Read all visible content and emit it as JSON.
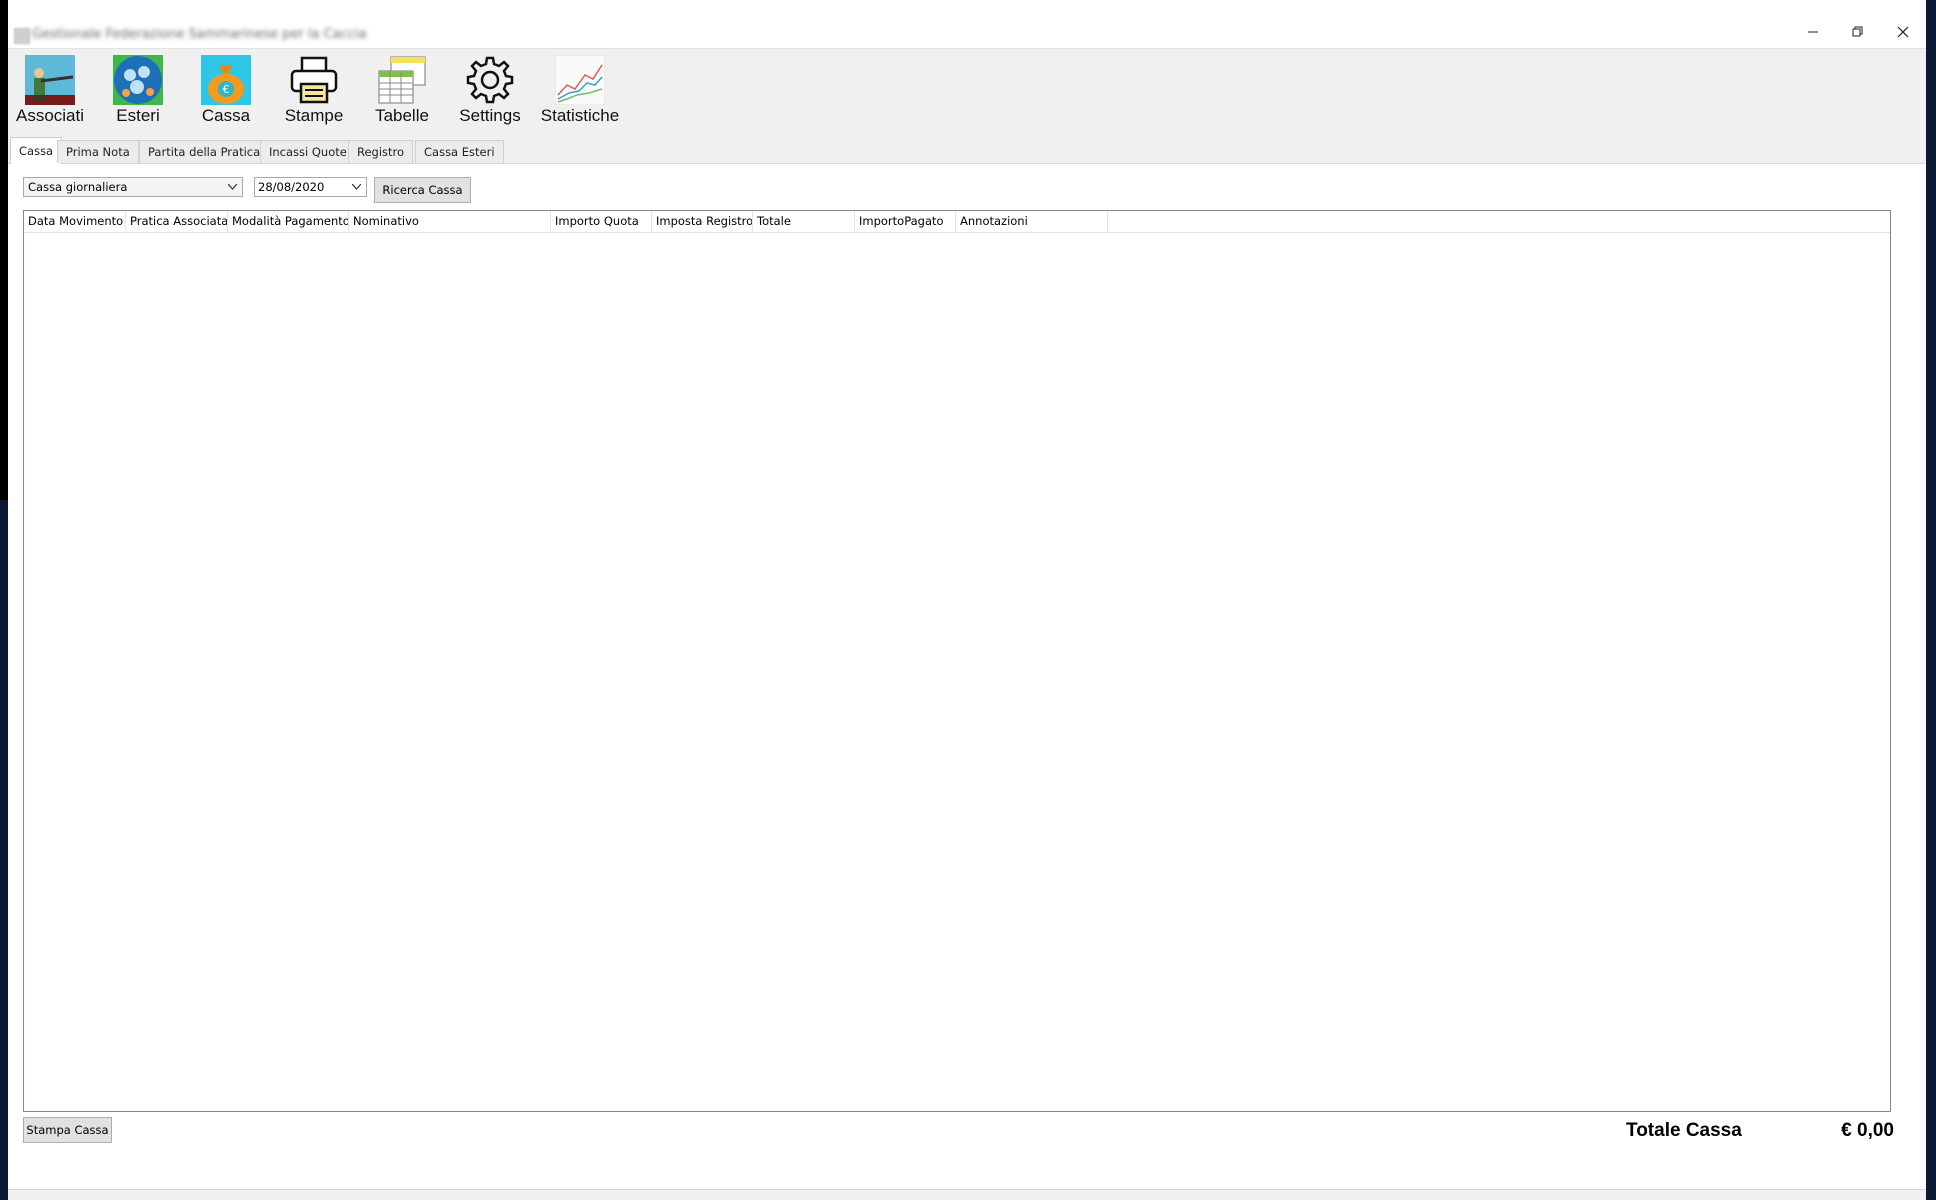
{
  "window": {
    "title": "Gestionale Federazione Sammarinese per la Caccia"
  },
  "toolbar": {
    "items": [
      {
        "label": "Associati",
        "icon": "hunter-icon"
      },
      {
        "label": "Esteri",
        "icon": "globe-people-icon"
      },
      {
        "label": "Cassa",
        "icon": "money-bag-icon"
      },
      {
        "label": "Stampe",
        "icon": "printer-icon"
      },
      {
        "label": "Tabelle",
        "icon": "table-icon"
      },
      {
        "label": "Settings",
        "icon": "gear-icon"
      },
      {
        "label": "Statistiche",
        "icon": "line-chart-icon"
      }
    ]
  },
  "tabs": [
    "Cassa",
    "Prima Nota",
    "Partita della Pratica",
    "Incassi Quote",
    "Registro",
    "Cassa Esteri"
  ],
  "active_tab": "Cassa",
  "filters": {
    "period_select": "Cassa giornaliera",
    "date": "28/08/2020",
    "search_button": "Ricerca Cassa"
  },
  "grid": {
    "columns": [
      "Data Movimento",
      "Pratica Associata",
      "Modalità Pagamento",
      "Nominativo",
      "Importo Quota",
      "Imposta Registro",
      "Totale",
      "ImportoPagato",
      "Annotazioni"
    ],
    "rows": []
  },
  "footer": {
    "print_button": "Stampa Cassa",
    "total_label": "Totale Cassa",
    "total_value": "€ 0,00"
  }
}
